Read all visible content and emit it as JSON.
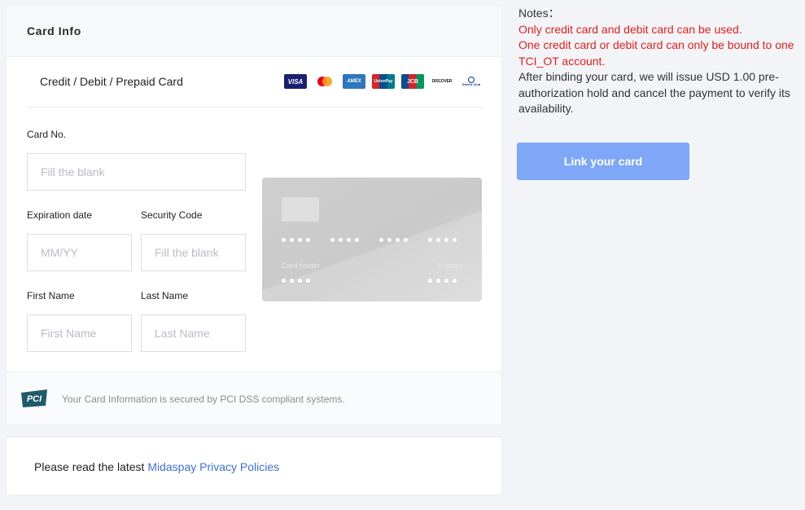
{
  "card_panel": {
    "title": "Card Info",
    "tab_label": "Credit / Debit / Prepaid Card",
    "card_logos": [
      {
        "name": "visa",
        "text": "VISA"
      },
      {
        "name": "mastercard",
        "text": ""
      },
      {
        "name": "amex",
        "text": "AMEX"
      },
      {
        "name": "unionpay",
        "text": "UnionPay"
      },
      {
        "name": "jcb",
        "text": "JCB"
      },
      {
        "name": "discover",
        "text": "DISCOVER"
      },
      {
        "name": "diners",
        "text": "Diners Club"
      }
    ],
    "card_no": {
      "label": "Card No.",
      "placeholder": "Fill the blank",
      "value": ""
    },
    "expiration": {
      "label": "Expiration date",
      "placeholder": "MM/YY",
      "value": ""
    },
    "security_code": {
      "label": "Security Code",
      "placeholder": "Fill the blank",
      "value": ""
    },
    "first_name": {
      "label": "First Name",
      "placeholder": "First Name",
      "value": ""
    },
    "last_name": {
      "label": "Last Name",
      "placeholder": "Last Name",
      "value": ""
    },
    "preview": {
      "holder_label": "Card holder",
      "expires_label": "Expires"
    },
    "pci": {
      "logo_text": "PCI",
      "text": "Your Card Information is secured by PCI DSS compliant systems."
    }
  },
  "privacy": {
    "prefix": "Please read the latest",
    "link_text": "Midaspay Privacy Policies"
  },
  "notes": {
    "title": "Notes：",
    "red_lines": [
      "Only credit card and debit card can be used.",
      "One credit card or debit card can only be bound to one TCI_OT account."
    ],
    "info": "After binding your card, we will issue USD 1.00 pre-authorization hold and cancel the payment to verify its availability."
  },
  "link_button": {
    "label": "Link your card"
  },
  "colors": {
    "accent": "#7ea7f7",
    "link": "#3f6fd8",
    "warning": "#e02020",
    "background": "#f3f4f7"
  }
}
